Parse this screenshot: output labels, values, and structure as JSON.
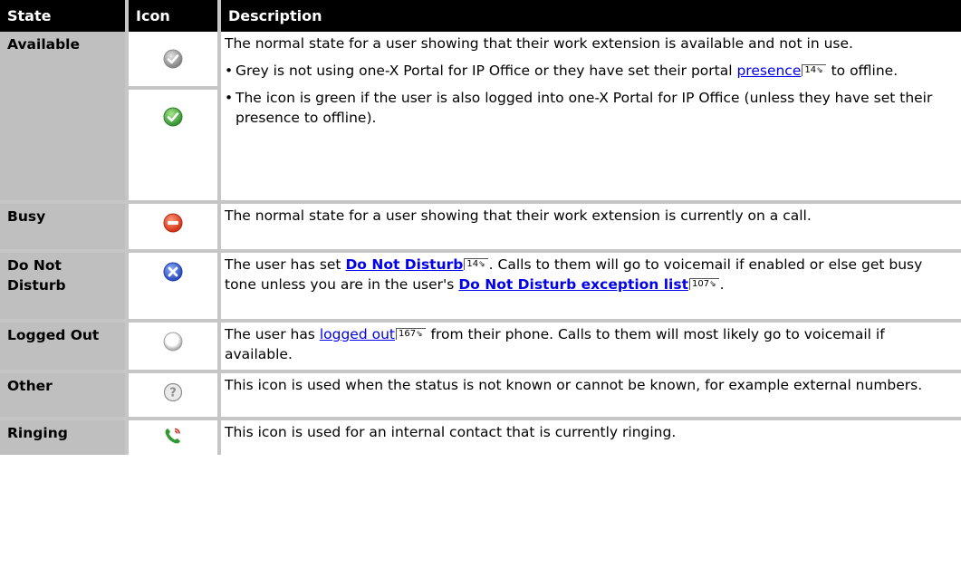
{
  "headers": {
    "state": "State",
    "icon": "Icon",
    "description": "Description"
  },
  "rows": {
    "available": {
      "state": "Available",
      "icons": [
        "available-grey-check-icon",
        "available-green-check-icon"
      ],
      "desc": "The normal state for a user showing that their work extension is available and not in use.",
      "bullet1_pre": "Grey is not using one-X Portal for IP Office or they have set their portal ",
      "bullet1_link": "presence",
      "bullet1_ref": "14",
      "bullet1_post": " to offline.",
      "bullet2": "The icon is green if the user is also logged into one-X Portal for IP Office (unless they have set their presence to offline)."
    },
    "busy": {
      "state": "Busy",
      "icon": "busy-icon",
      "desc": "The normal state for a user showing that their work extension is currently on a call."
    },
    "dnd": {
      "state": "Do Not Disturb",
      "icon": "dnd-icon",
      "desc_pre": "The user has set ",
      "link1": "Do Not Disturb",
      "ref1": "14",
      "desc_mid": ". Calls to them will go to voicemail if enabled or else get busy tone unless you are in the user's ",
      "link2": "Do Not Disturb exception list",
      "ref2": "107",
      "desc_post": "."
    },
    "logged_out": {
      "state": "Logged Out",
      "icon": "logged-out-icon",
      "desc_pre": "The user has ",
      "link": "logged out",
      "ref": "167",
      "desc_post": " from their phone. Calls to them will most likely go to voicemail if available."
    },
    "other": {
      "state": "Other",
      "icon": "question-icon",
      "desc": "This icon is used when the status is not known or cannot be known, for example external numbers."
    },
    "ringing": {
      "state": "Ringing",
      "icon": "ringing-phone-icon",
      "desc": "This icon is used for an internal contact that is currently ringing."
    }
  },
  "colors": {
    "header_bg": "#000000",
    "state_bg": "#bfbfbf",
    "border": "#c6c6c6",
    "link": "#0000ee",
    "green": "#3fa83f",
    "red": "#e63b1e",
    "blue": "#2f56c9"
  }
}
